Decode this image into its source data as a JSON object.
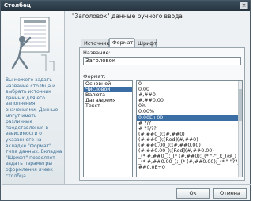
{
  "window": {
    "title": "Столбец",
    "close_glyph": "×"
  },
  "heading": "\"Заголовок\" данные ручного ввода",
  "help_text": "Вы можете задать название столбца и выбрать источник данных для его заполнения значениями. Данные могут иметь различные представления в зависимости от указанного на вкладке \"Формат\" типа данных. Вкладка \"Шрифт\" позволяет задать параметры оформления ячеек столбца.",
  "tabs": [
    {
      "label": "Источник",
      "active": false
    },
    {
      "label": "Формат",
      "active": true
    },
    {
      "label": "Шрифт",
      "active": false
    }
  ],
  "name_label": "Название:",
  "name_value": "Заголовок",
  "format_label": "Формат:",
  "categories": [
    {
      "label": "Основной",
      "selected": false
    },
    {
      "label": "Числовой",
      "selected": true
    },
    {
      "label": "Валюта",
      "selected": false
    },
    {
      "label": "Дата/время",
      "selected": false
    },
    {
      "label": "Текст",
      "selected": false
    }
  ],
  "formats": [
    {
      "label": "0",
      "selected": false
    },
    {
      "label": "0.00",
      "selected": false
    },
    {
      "label": "#,##0",
      "selected": false
    },
    {
      "label": "#,##0.00",
      "selected": false
    },
    {
      "label": "0%",
      "selected": false
    },
    {
      "label": "0.00%",
      "selected": false
    },
    {
      "label": "0.00E+00",
      "selected": true
    },
    {
      "label": "# ?/?",
      "selected": false
    },
    {
      "label": "# ??/??",
      "selected": false
    },
    {
      "label": "(#,##0_);(#,##0)",
      "selected": false
    },
    {
      "label": "(#,##0_);[Red](#,##0)",
      "selected": false
    },
    {
      "label": "(#,##0.00_);(#,##0.00)",
      "selected": false
    },
    {
      "label": "(#,##0.00_);[Red](#,##0.00)",
      "selected": false
    },
    {
      "label": "_(* #,##0_);_(* (#,##0);_(* \"-\"_);_(@_)",
      "selected": false
    },
    {
      "label": "_(* #,##0.00_);_(* (#,##0.00);_(* \"-\"??_);_(@_)",
      "selected": false
    },
    {
      "label": "##0.0E+0",
      "selected": false
    }
  ],
  "buttons": {
    "ok": "Ок",
    "cancel": "Отмена"
  }
}
